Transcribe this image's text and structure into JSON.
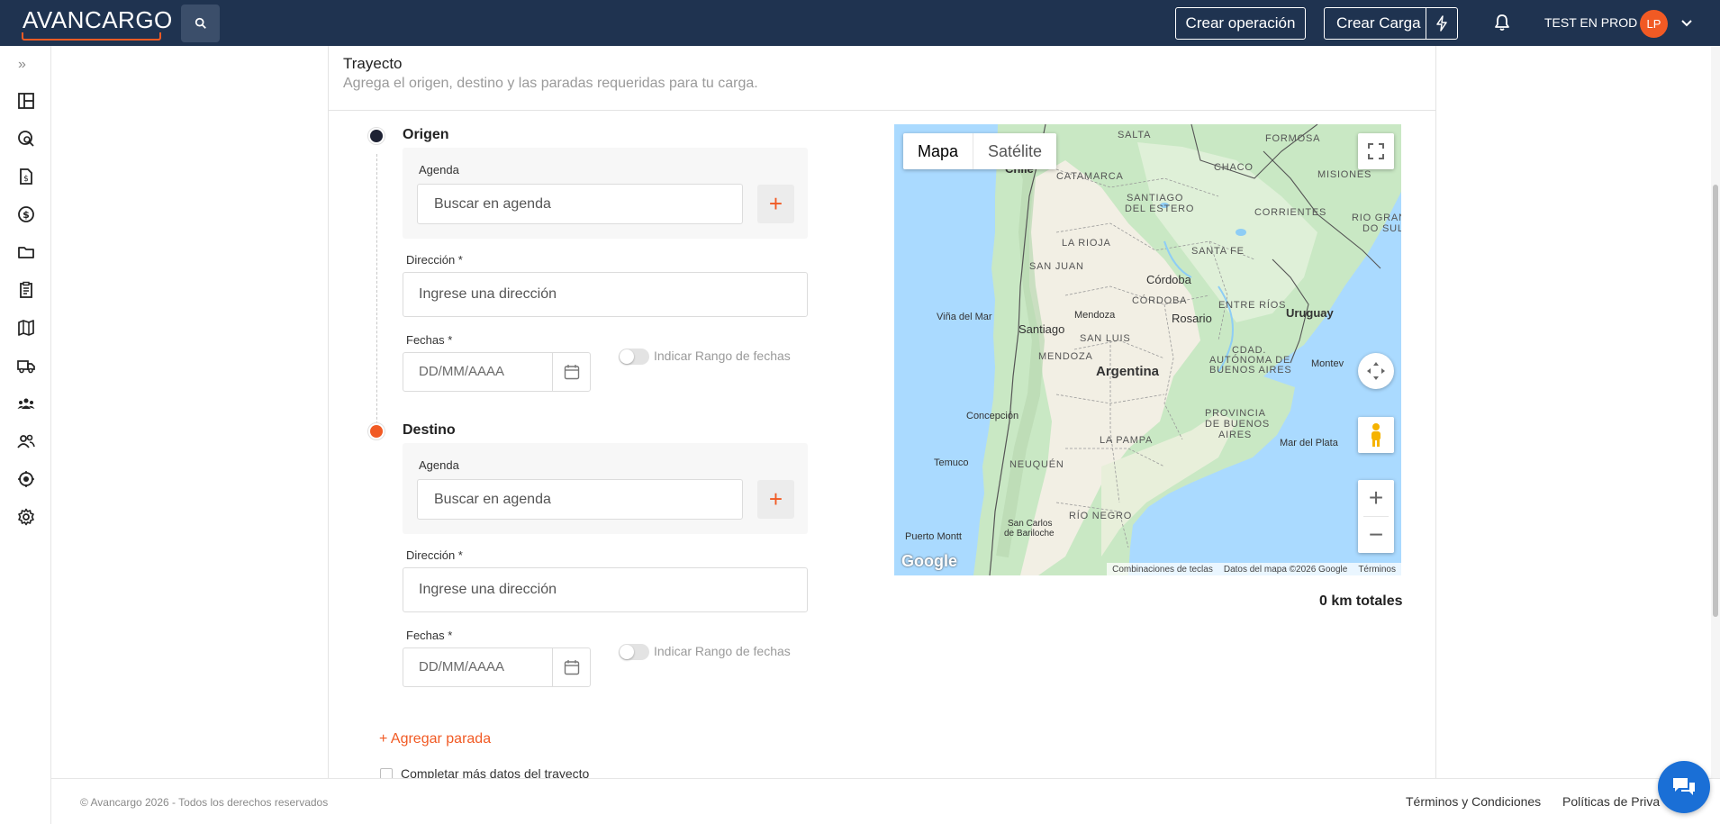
{
  "header": {
    "logo": "AVANCARGO",
    "create_operation": "Crear operación",
    "create_load": "Crear Carga",
    "user_name": "TEST EN PROD",
    "avatar_initials": "LP",
    "brand_color": "#f15a24",
    "nav_color": "#1f3350"
  },
  "sidebar": {
    "expand_glyph": "»",
    "icons": [
      "dashboard-icon",
      "search-location-icon",
      "invoice-icon",
      "dollar-icon",
      "folder-icon",
      "clipboard-icon",
      "map-icon",
      "truck-icon",
      "group-icon",
      "users-icon",
      "location-target-icon",
      "settings-icon"
    ]
  },
  "section": {
    "title": "Trayecto",
    "subtitle": "Agrega el origen, destino y las paradas requeridas para tu carga."
  },
  "origin": {
    "label": "Origen",
    "agenda_label": "Agenda",
    "agenda_placeholder": "Buscar en agenda",
    "address_label": "Dirección *",
    "address_placeholder": "Ingrese una dirección",
    "dates_label": "Fechas *",
    "date_placeholder": "DD/MM/AAAA",
    "range_toggle_label": "Indicar Rango de fechas"
  },
  "destination": {
    "label": "Destino",
    "agenda_label": "Agenda",
    "agenda_placeholder": "Buscar en agenda",
    "address_label": "Dirección *",
    "address_placeholder": "Ingrese una dirección",
    "dates_label": "Fechas *",
    "date_placeholder": "DD/MM/AAAA",
    "range_toggle_label": "Indicar Rango de fechas"
  },
  "add_stop": "+ Agregar parada",
  "more_data_checkbox": "Completar más datos del trayecto",
  "map": {
    "type_map": "Mapa",
    "type_satellite": "Satélite",
    "labels": {
      "salta": "SALTA",
      "formosa": "FORMOSA",
      "chile": "Chile",
      "catamarca": "CATAMARCA",
      "chaco": "CHACO",
      "misiones": "MISIONES",
      "santiago": "SANTIAGO",
      "del_estero": "DEL ESTERO",
      "corrientes": "CORRIENTES",
      "rio_grande": "RIO GRAND",
      "do_sul": "DO SUL",
      "la_rioja": "LA RIOJA",
      "san_juan": "SAN JUAN",
      "santa_fe": "SANTA FE",
      "cordoba_city": "Córdoba",
      "cordoba_prov": "CÓRDOBA",
      "entre_rios": "ENTRE RÍOS",
      "uruguay": "Uruguay",
      "vina_del_mar": "Viña del Mar",
      "santiago_city": "Santiago",
      "mendoza_city": "Mendoza",
      "rosario": "Rosario",
      "san_luis": "SAN LUIS",
      "mendoza_prov": "MENDOZA",
      "caba_1": "CDAD.",
      "caba_2": "AUTÓNOMA DE",
      "caba_3": "BUENOS AIRES",
      "montevideo": "Montev",
      "argentina": "Argentina",
      "concepcion": "Concepción",
      "pba_1": "PROVINCIA",
      "pba_2": "DE BUENOS",
      "pba_3": "AIRES",
      "la_pampa": "LA PAMPA",
      "mar_del_plata": "Mar del Plata",
      "temuco": "Temuco",
      "neuquen": "NEUQUÉN",
      "rio_negro": "RÍO NEGRO",
      "san_carlos": "San Carlos",
      "de_bariloche": "de Bariloche",
      "puerto_montt": "Puerto Montt"
    },
    "google": "Google",
    "footer_shortcuts": "Combinaciones de teclas",
    "footer_data": "Datos del mapa ©2026 Google",
    "footer_terms": "Términos"
  },
  "km_total": "0 km totales",
  "footer": {
    "copyright": "© Avancargo 2026 - Todos los derechos reservados",
    "terms": "Términos y Condiciones",
    "privacy": "Políticas de Priva"
  }
}
